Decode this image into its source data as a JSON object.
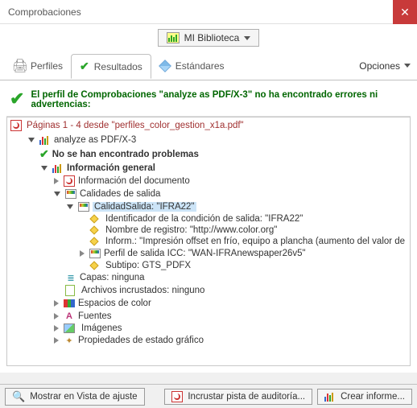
{
  "titlebar": {
    "title": "Comprobaciones"
  },
  "library": {
    "label": "MI Biblioteca"
  },
  "tabs": {
    "profiles": "Perfiles",
    "results": "Resultados",
    "standards": "Estándares",
    "options": "Opciones"
  },
  "summary": "El perfil de Comprobaciones \"analyze as PDF/X-3\" no ha encontrado errores ni advertencias:",
  "pages_line": "Páginas 1 - 4 desde \"perfiles_color_gestion_x1a.pdf\"",
  "tree": {
    "analyze": "analyze as PDF/X-3",
    "no_problems": "No se han encontrado problemas",
    "info_general": "Información general",
    "doc_info": "Información del documento",
    "output_quality": "Calidades de salida",
    "output_item": "CalidadSalida: \"IFRA22\"",
    "output_cond": "Identificador de la condición de salida: \"IFRA22\"",
    "reg_name": "Nombre de registro: \"http://www.color.org\"",
    "inform": "Inform.: \"Impresión offset en frío, equipo a plancha (aumento del valor de",
    "icc_profile": "Perfil de salida ICC: \"WAN-IFRAnewspaper26v5\"",
    "subtype": "Subtipo: GTS_PDFX",
    "layers": "Capas: ninguna",
    "embedded": "Archivos incrustados: ninguno",
    "colorspaces": "Espacios de color",
    "fonts": "Fuentes",
    "images": "Imágenes",
    "graphic_props": "Propiedades de estado gráfico"
  },
  "buttons": {
    "show_snap": "Mostrar en Vista de ajuste",
    "embed_audit": "Incrustar pista de auditoría...",
    "create_report": "Crear informe..."
  }
}
